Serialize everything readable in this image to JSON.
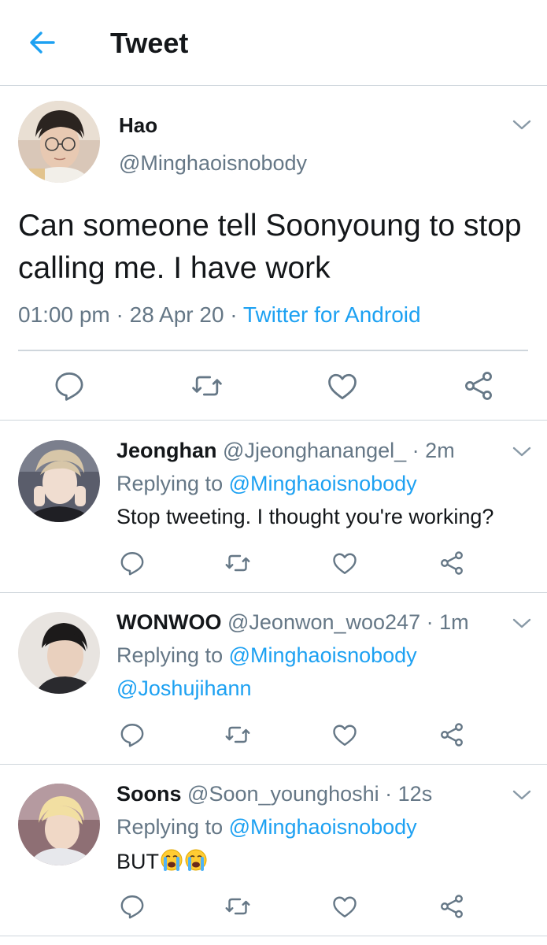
{
  "header": {
    "title": "Tweet",
    "back_icon": "back-arrow-icon",
    "accent": "#1da1f2"
  },
  "main_tweet": {
    "name": "Hao",
    "handle": "@Minghaoisnobody",
    "text": "Can someone tell Soonyoung to stop calling me. I have work",
    "time": "01:00 pm",
    "date": "28 Apr 20",
    "source": "Twitter for Android",
    "sep": "·",
    "actions": [
      "reply-icon",
      "retweet-icon",
      "like-icon",
      "share-icon"
    ]
  },
  "replies": [
    {
      "name": "Jeonghan",
      "handle": "@Jjeonghanangel_",
      "time": "2m",
      "sep": "·",
      "replying_label": "Replying to",
      "mention1": "@Minghaoisnobody",
      "mention2": "",
      "text": "Stop tweeting. I thought you're working?"
    },
    {
      "name": "WONWOO",
      "handle": "@Jeonwon_woo247",
      "time": "1m",
      "sep": "·",
      "replying_label": "Replying to",
      "mention1": "@Minghaoisnobody",
      "mention2": "@Joshujihann",
      "text": ""
    },
    {
      "name": "Soons",
      "handle": "@Soon_younghoshi",
      "time": "12s",
      "sep": "·",
      "replying_label": "Replying to",
      "mention1": "@Minghaoisnobody",
      "mention2": "",
      "text": "BUT",
      "emoji": "crying-face-emoji"
    }
  ],
  "colors": {
    "text": "#14171a",
    "muted": "#657786",
    "link": "#1da1f2",
    "divider": "#cfd6dc"
  }
}
